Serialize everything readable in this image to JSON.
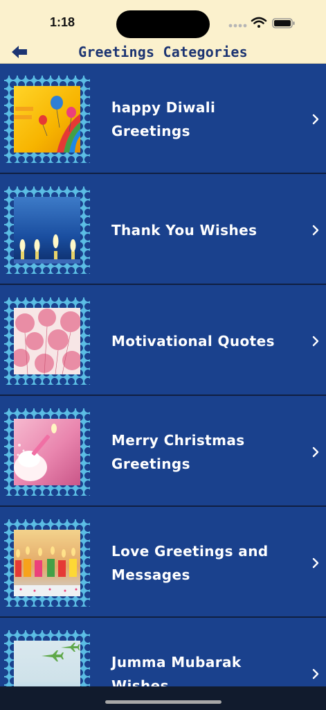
{
  "status": {
    "time": "1:18"
  },
  "nav": {
    "title": "Greetings Categories",
    "back_icon": "back-arrow-icon"
  },
  "categories": [
    {
      "label": "happy Diwali Greetings"
    },
    {
      "label": "Thank You Wishes"
    },
    {
      "label": "Motivational Quotes"
    },
    {
      "label": "Merry Christmas Greetings"
    },
    {
      "label": "Love Greetings and Messages"
    },
    {
      "label": "Jumma Mubarak Wishes"
    }
  ],
  "colors": {
    "background": "#1a418d",
    "header": "#fbf1cd",
    "stamp": "#5bbde4",
    "title": "#1c3472"
  }
}
